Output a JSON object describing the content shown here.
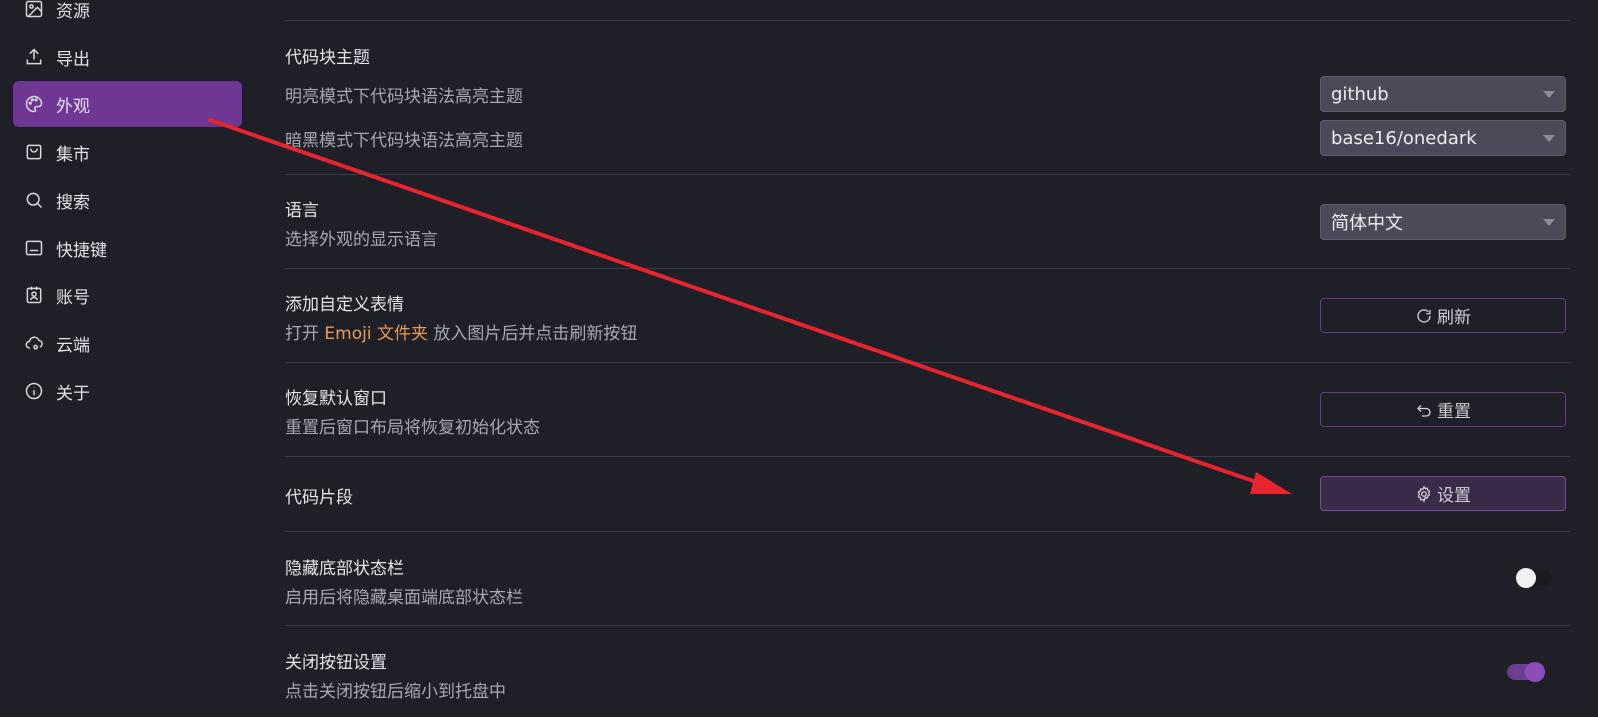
{
  "sidebar": {
    "items": [
      {
        "label": "资源",
        "icon": "image-icon"
      },
      {
        "label": "导出",
        "icon": "upload-icon"
      },
      {
        "label": "外观",
        "icon": "palette-icon",
        "active": true
      },
      {
        "label": "集市",
        "icon": "shopping-bag-icon"
      },
      {
        "label": "搜索",
        "icon": "search-icon"
      },
      {
        "label": "快捷键",
        "icon": "keyboard-icon"
      },
      {
        "label": "账号",
        "icon": "account-icon"
      },
      {
        "label": "云端",
        "icon": "cloud-settings-icon"
      },
      {
        "label": "关于",
        "icon": "info-icon"
      }
    ]
  },
  "settings": {
    "code_theme": {
      "title": "代码块主题",
      "light_label": "明亮模式下代码块语法高亮主题",
      "light_value": "github",
      "dark_label": "暗黑模式下代码块语法高亮主题",
      "dark_value": "base16/onedark"
    },
    "language": {
      "title": "语言",
      "desc": "选择外观的显示语言",
      "value": "简体中文"
    },
    "emoji": {
      "title": "添加自定义表情",
      "desc_prefix": "打开",
      "desc_link": "Emoji 文件夹",
      "desc_suffix": "放入图片后并点击刷新按钮",
      "button": "刷新"
    },
    "reset_window": {
      "title": "恢复默认窗口",
      "desc": "重置后窗口布局将恢复初始化状态",
      "button": "重置"
    },
    "snippets": {
      "title": "代码片段",
      "button": "设置"
    },
    "hide_statusbar": {
      "title": "隐藏底部状态栏",
      "desc": "启用后将隐藏桌面端底部状态栏",
      "enabled": false
    },
    "close_button": {
      "title": "关闭按钮设置",
      "desc": "点击关闭按钮后缩小到托盘中",
      "enabled": true
    }
  },
  "colors": {
    "accent": "#6e3794",
    "background": "#1f1f28",
    "annotation_arrow": "#e8242c",
    "link": "#e99a58"
  }
}
